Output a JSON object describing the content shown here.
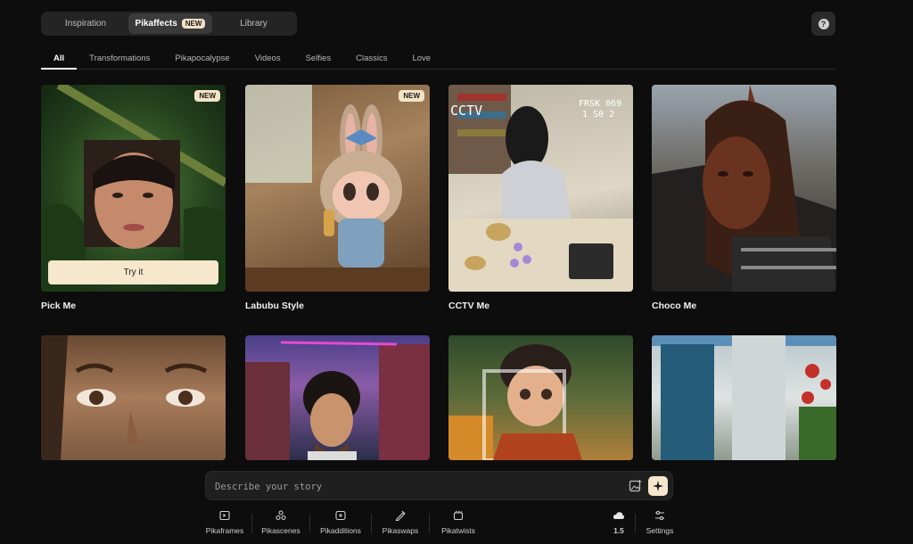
{
  "top_nav": {
    "tabs": [
      {
        "label": "Inspiration"
      },
      {
        "label": "Pikaffects",
        "badge": "NEW"
      },
      {
        "label": "Library"
      }
    ],
    "help_label": "?"
  },
  "categories": [
    "All",
    "Transformations",
    "Pikapocalypse",
    "Videos",
    "Selfies",
    "Classics",
    "Love"
  ],
  "cards": [
    {
      "title": "Pick Me",
      "badge": "NEW",
      "action": "Try it"
    },
    {
      "title": "Labubu Style",
      "badge": "NEW"
    },
    {
      "title": "CCTV Me"
    },
    {
      "title": "Choco Me"
    },
    {
      "title": ""
    },
    {
      "title": ""
    },
    {
      "title": ""
    },
    {
      "title": ""
    }
  ],
  "cctv_overlay": {
    "label": "CCTV",
    "stamp_line1": "FRSK 069",
    "stamp_line2": "1 S0 2"
  },
  "prompt": {
    "placeholder": "Describe your story"
  },
  "tools": [
    {
      "label": "Pikaframes",
      "icon": "frames-icon"
    },
    {
      "label": "Pikascenes",
      "icon": "scenes-icon"
    },
    {
      "label": "Pikadditions",
      "icon": "additions-icon"
    },
    {
      "label": "Pikaswaps",
      "icon": "swaps-icon"
    },
    {
      "label": "Pikatwists",
      "icon": "twists-icon"
    }
  ],
  "model": {
    "label": "1.5",
    "icon": "cloud-icon"
  },
  "settings": {
    "label": "Settings",
    "icon": "sliders-icon"
  },
  "colors": {
    "accent": "#f6e7cd",
    "background": "#0d0d0d",
    "panel": "#242424"
  }
}
